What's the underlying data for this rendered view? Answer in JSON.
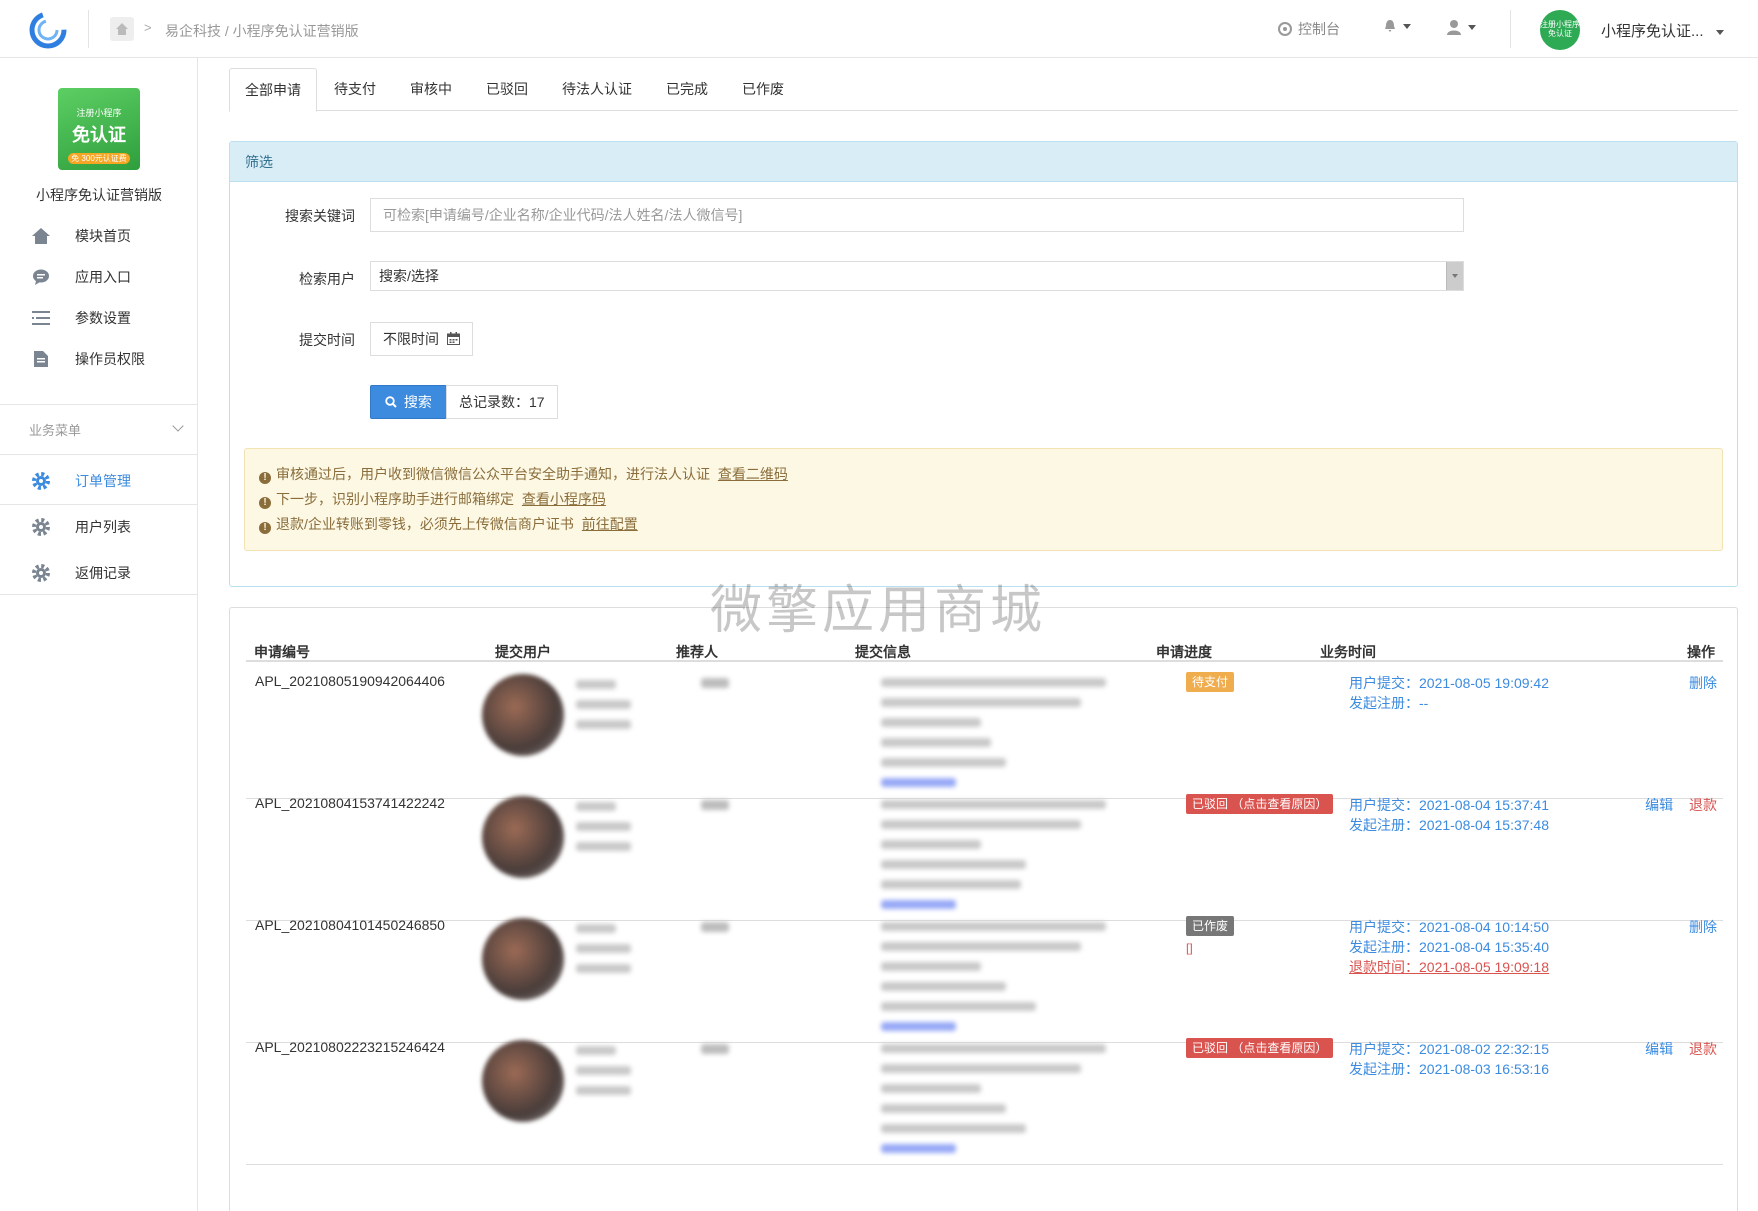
{
  "breadcrumb": [
    "易企科技",
    "/",
    "小程序免认证营销版"
  ],
  "topbar": {
    "console": "控制台",
    "avatar_text": "注册小程序免认证",
    "app_name": "小程序免认证..."
  },
  "sidebar": {
    "logo_lines": [
      "注册小程序",
      "免认证",
      "免 300元认证费"
    ],
    "app_title": "小程序免认证营销版",
    "items": [
      {
        "label": "模块首页",
        "icon": "home-icon"
      },
      {
        "label": "应用入口",
        "icon": "chat-icon"
      },
      {
        "label": "参数设置",
        "icon": "list-icon"
      },
      {
        "label": "操作员权限",
        "icon": "document-icon"
      }
    ],
    "biz_menu": "业务菜单",
    "biz_items": [
      {
        "label": "订单管理",
        "icon": "gear-icon",
        "active": true
      },
      {
        "label": "用户列表",
        "icon": "gear-icon"
      },
      {
        "label": "返佣记录",
        "icon": "gear-icon"
      }
    ]
  },
  "tabs": [
    "全部申请",
    "待支付",
    "审核中",
    "已驳回",
    "待法人认证",
    "已完成",
    "已作废"
  ],
  "filter": {
    "title": "筛选",
    "keyword_label": "搜索关键词",
    "keyword_placeholder": "可检索[申请编号/企业名称/企业代码/法人姓名/法人微信号]",
    "user_label": "检索用户",
    "user_value": "搜索/选择",
    "time_label": "提交时间",
    "time_value": "不限时间",
    "search_button": "搜索",
    "total": "总记录数：17"
  },
  "notices": [
    {
      "text": "审核通过后，用户收到微信微信公众平台安全助手通知，进行法人认证",
      "link": "查看二维码"
    },
    {
      "text": "下一步，识别小程序助手进行邮箱绑定",
      "link": "查看小程序码"
    },
    {
      "text": "退款/企业转账到零钱，必须先上传微信商户证书",
      "link": "前往配置"
    }
  ],
  "watermark": "微擎应用商城",
  "table": {
    "headers": [
      "申请编号",
      "提交用户",
      "推荐人",
      "提交信息",
      "申请进度",
      "业务时间",
      "操作"
    ],
    "rows": [
      {
        "id": "APL_20210805190942064406",
        "status": "待支付",
        "status_type": "pay",
        "times": [
          "用户提交：2021-08-05 19:09:42",
          "发起注册：--"
        ],
        "ops": [
          "删除"
        ]
      },
      {
        "id": "APL_20210804153741422242",
        "status": "已驳回 （点击查看原因）",
        "status_type": "rej",
        "times": [
          "用户提交：2021-08-04 15:37:41",
          "发起注册：2021-08-04 15:37:48"
        ],
        "ops": [
          "编辑",
          "退款"
        ]
      },
      {
        "id": "APL_20210804101450246850",
        "status": "已作废",
        "status_type": "void",
        "extra": "[]",
        "times": [
          "用户提交：2021-08-04 10:14:50",
          "发起注册：2021-08-04 15:35:40"
        ],
        "refund_time": "退款时间：2021-08-05 19:09:18",
        "ops": [
          "删除"
        ]
      },
      {
        "id": "APL_20210802223215246424",
        "status": "已驳回 （点击查看原因）",
        "status_type": "rej",
        "times": [
          "用户提交：2021-08-02 22:32:15",
          "发起注册：2021-08-03 16:53:16"
        ],
        "ops": [
          "编辑",
          "退款"
        ]
      }
    ]
  },
  "colors": {
    "accent": "#3c8bdf",
    "danger": "#d9534f",
    "warning": "#f0ad4e"
  }
}
